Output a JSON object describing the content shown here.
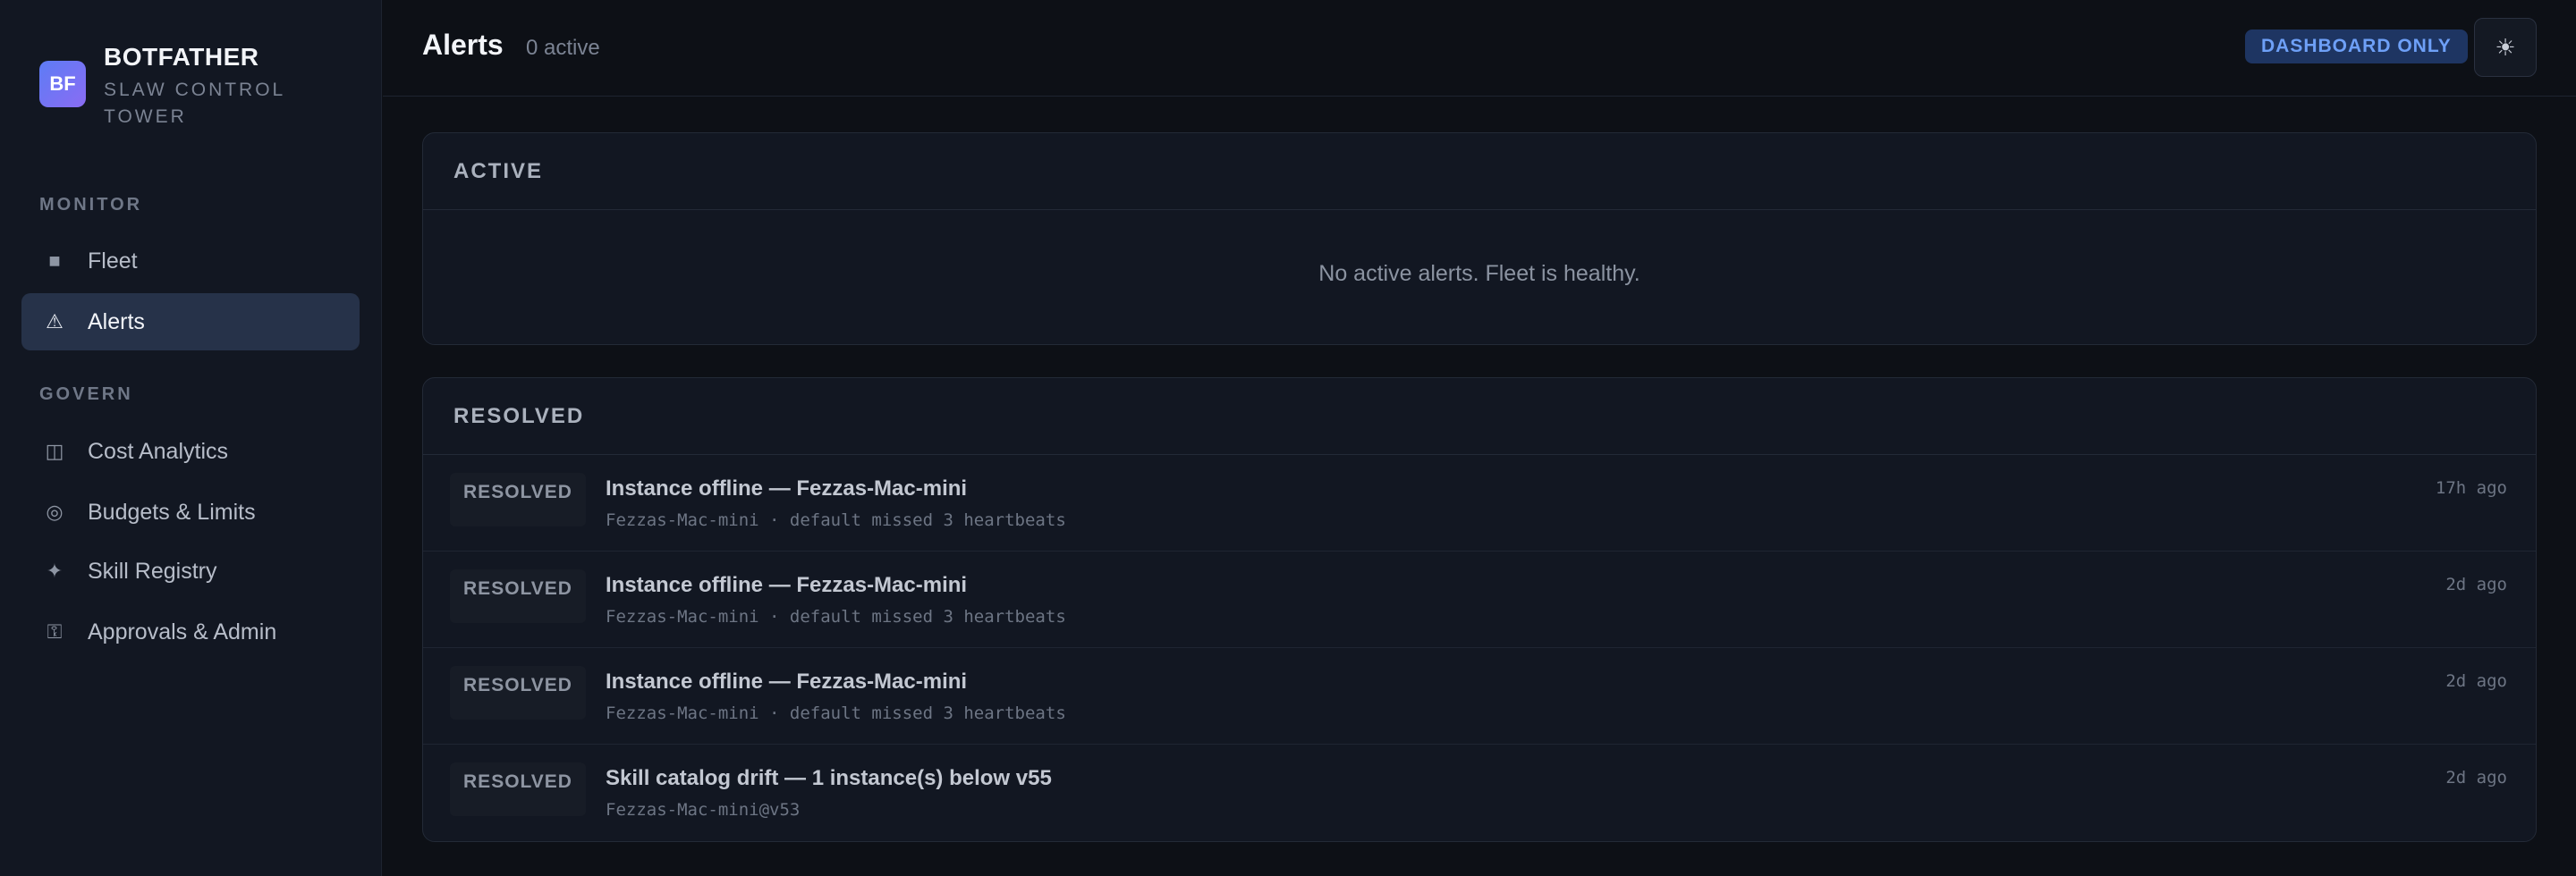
{
  "brand": {
    "logo_text": "BF",
    "name": "BOTFATHER",
    "subtitle": "SLAW CONTROL TOWER"
  },
  "sidebar": {
    "sections": [
      {
        "label": "MONITOR",
        "items": [
          {
            "label": "Fleet",
            "icon": "square-icon",
            "glyph": "■",
            "active": false
          },
          {
            "label": "Alerts",
            "icon": "warning-triangle-icon",
            "glyph": "⚠",
            "active": true
          }
        ]
      },
      {
        "label": "GOVERN",
        "items": [
          {
            "label": "Cost Analytics",
            "icon": "panel-icon",
            "glyph": "◫",
            "active": false
          },
          {
            "label": "Budgets & Limits",
            "icon": "target-icon",
            "glyph": "◎",
            "active": false
          },
          {
            "label": "Skill Registry",
            "icon": "sparkle-icon",
            "glyph": "✦",
            "active": false
          },
          {
            "label": "Approvals & Admin",
            "icon": "id-icon",
            "glyph": "⚿",
            "active": false
          }
        ]
      }
    ]
  },
  "header": {
    "title": "Alerts",
    "active_count": "0 active",
    "badge": "DASHBOARD ONLY",
    "theme_icon": "☀"
  },
  "active_section": {
    "title": "ACTIVE",
    "empty_text": "No active alerts. Fleet is healthy."
  },
  "resolved_section": {
    "title": "RESOLVED",
    "rows": [
      {
        "status": "RESOLVED",
        "title": "Instance offline — Fezzas-Mac-mini",
        "detail": "Fezzas-Mac-mini · default missed 3 heartbeats",
        "time": "17h ago"
      },
      {
        "status": "RESOLVED",
        "title": "Instance offline — Fezzas-Mac-mini",
        "detail": "Fezzas-Mac-mini · default missed 3 heartbeats",
        "time": "2d ago"
      },
      {
        "status": "RESOLVED",
        "title": "Instance offline — Fezzas-Mac-mini",
        "detail": "Fezzas-Mac-mini · default missed 3 heartbeats",
        "time": "2d ago"
      },
      {
        "status": "RESOLVED",
        "title": "Skill catalog drift — 1 instance(s) below v55",
        "detail": "Fezzas-Mac-mini@v53",
        "time": "2d ago"
      }
    ]
  }
}
